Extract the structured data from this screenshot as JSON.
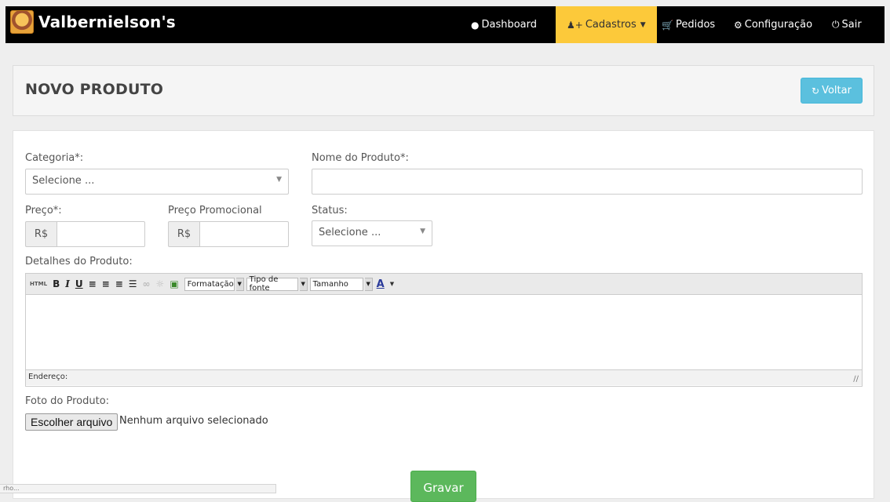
{
  "brand": {
    "name": "Valbernielson's",
    "logo_icon": "burger-logo-icon"
  },
  "nav": {
    "dashboard": "Dashboard",
    "cadastros": "Cadastros",
    "pedidos": "Pedidos",
    "configuracao": "Configuração",
    "sair": "Sair",
    "active_color": "#fcc93a"
  },
  "page": {
    "title": "NOVO PRODUTO",
    "back_button": "Voltar"
  },
  "form": {
    "categoria_label": "Categoria*:",
    "categoria_value": "Selecione ...",
    "nome_label": "Nome do Produto*:",
    "nome_value": "",
    "preco_label": "Preço*:",
    "preco_prefix": "R$",
    "preco_value": "",
    "preco_promo_label": "Preço Promocional",
    "preco_promo_prefix": "R$",
    "preco_promo_value": "",
    "status_label": "Status:",
    "status_value": "Selecione ...",
    "detalhes_label": "Detalhes do Produto:",
    "foto_label": "Foto do Produto:",
    "file_button": "Escolher arquivo",
    "file_status": "Nenhum arquivo selecionado",
    "submit": "Gravar"
  },
  "editor": {
    "html": "HTML",
    "bold": "B",
    "italic": "I",
    "underline": "U",
    "formatacao": "Formatação",
    "tipo_fonte": "Tipo de fonte",
    "tamanho": "Tamanho",
    "font_color": "A",
    "status_label": "Endereço:"
  },
  "browser_status": "rho..."
}
